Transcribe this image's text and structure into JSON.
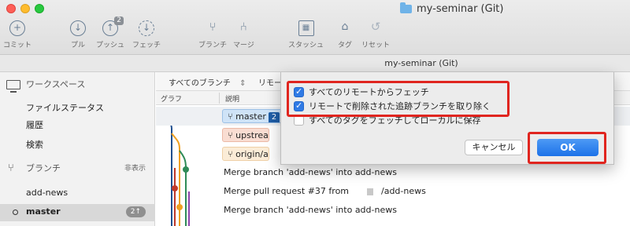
{
  "window": {
    "title": "my-seminar (Git)"
  },
  "toolbar": {
    "commit": "コミット",
    "pull": "プル",
    "push": "プッシュ",
    "push_badge": "2",
    "fetch": "フェッチ",
    "branch": "ブランチ",
    "merge": "マージ",
    "stash": "スタッシュ",
    "tag": "タグ",
    "reset": "リセット"
  },
  "subheader": {
    "title": "my-seminar (Git)"
  },
  "sidebar": {
    "workspace": "ワークスペース",
    "file_status": "ファイルステータス",
    "history": "履歴",
    "search": "検索",
    "branches": "ブランチ",
    "hide": "非表示",
    "items": [
      {
        "label": "add-news"
      },
      {
        "label": "master",
        "badge": "2↑"
      }
    ]
  },
  "filter": {
    "all_branches": "すべてのブランチ",
    "sort_symbol": "⇕",
    "remote_partial": "リモー"
  },
  "columns": {
    "graph": "グラフ",
    "description": "説明"
  },
  "commits": {
    "tag_master": "master",
    "tag_master_num": "2",
    "tag_upstream": "upstream/ac",
    "tag_origin": "origin/add-n",
    "msg1": "Merge branch 'add-news' into add-news",
    "msg2": "Merge pull request #37 from",
    "msg2_suffix": "/add-news",
    "msg3": "Merge branch 'add-news' into add-news"
  },
  "dialog": {
    "fetch_all_remotes": "すべてのリモートからフェッチ",
    "prune_remote_branches": "リモートで削除された追跡ブランチを取り除く",
    "fetch_all_tags": "すべてのタグをフェッチしてローカルに保存",
    "checked": [
      true,
      true,
      false
    ],
    "cancel": "キャンセル",
    "ok": "OK"
  },
  "colors": {
    "accent": "#2f7ae5",
    "highlight": "#e0251f"
  }
}
